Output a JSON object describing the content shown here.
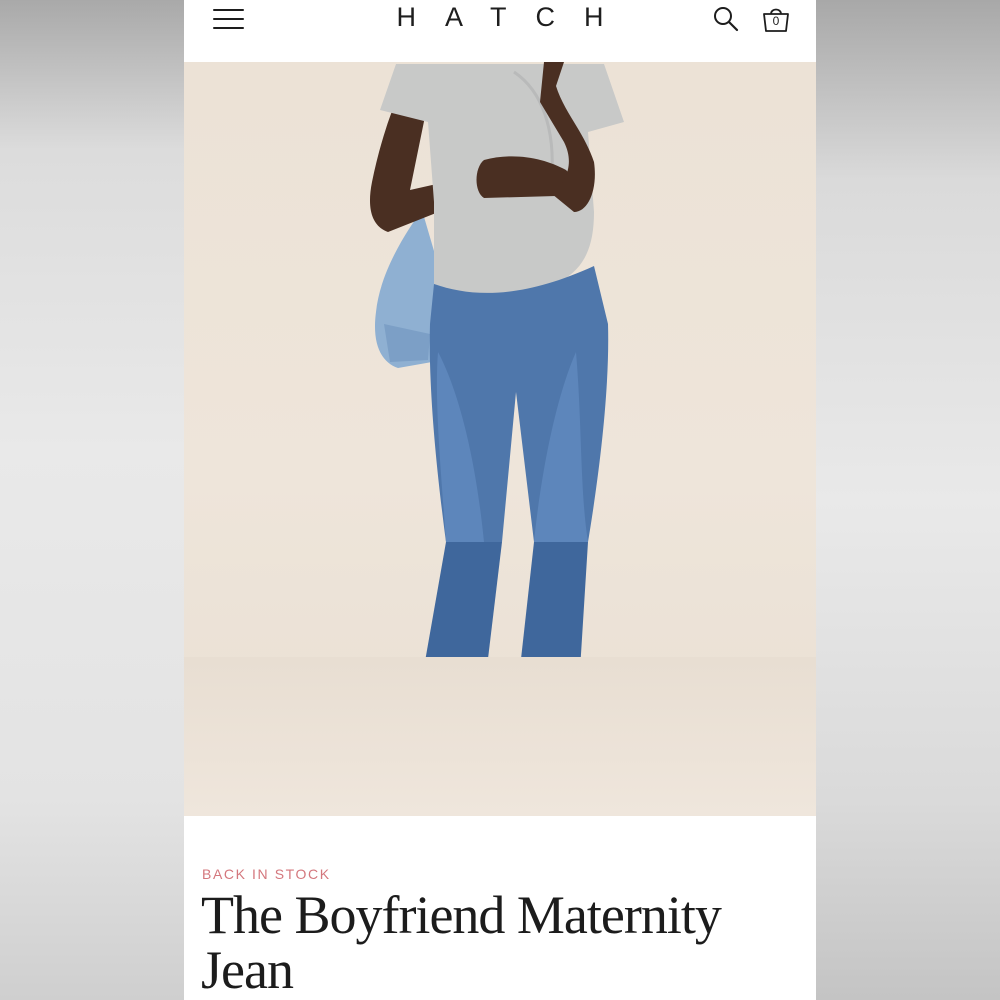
{
  "header": {
    "brand": "HATCH",
    "menu_icon": "hamburger-menu-icon",
    "search_icon": "search-icon",
    "cart_icon": "shopping-bag-icon",
    "cart_count": "0"
  },
  "product": {
    "badge": "BACK IN STOCK",
    "title": "The Boyfriend Maternity Jean",
    "image": "model-in-maternity-jeans-photo"
  },
  "colors": {
    "badge": "#d4777d",
    "text": "#1c1c1c",
    "hero_bg": "#ece2d6"
  }
}
